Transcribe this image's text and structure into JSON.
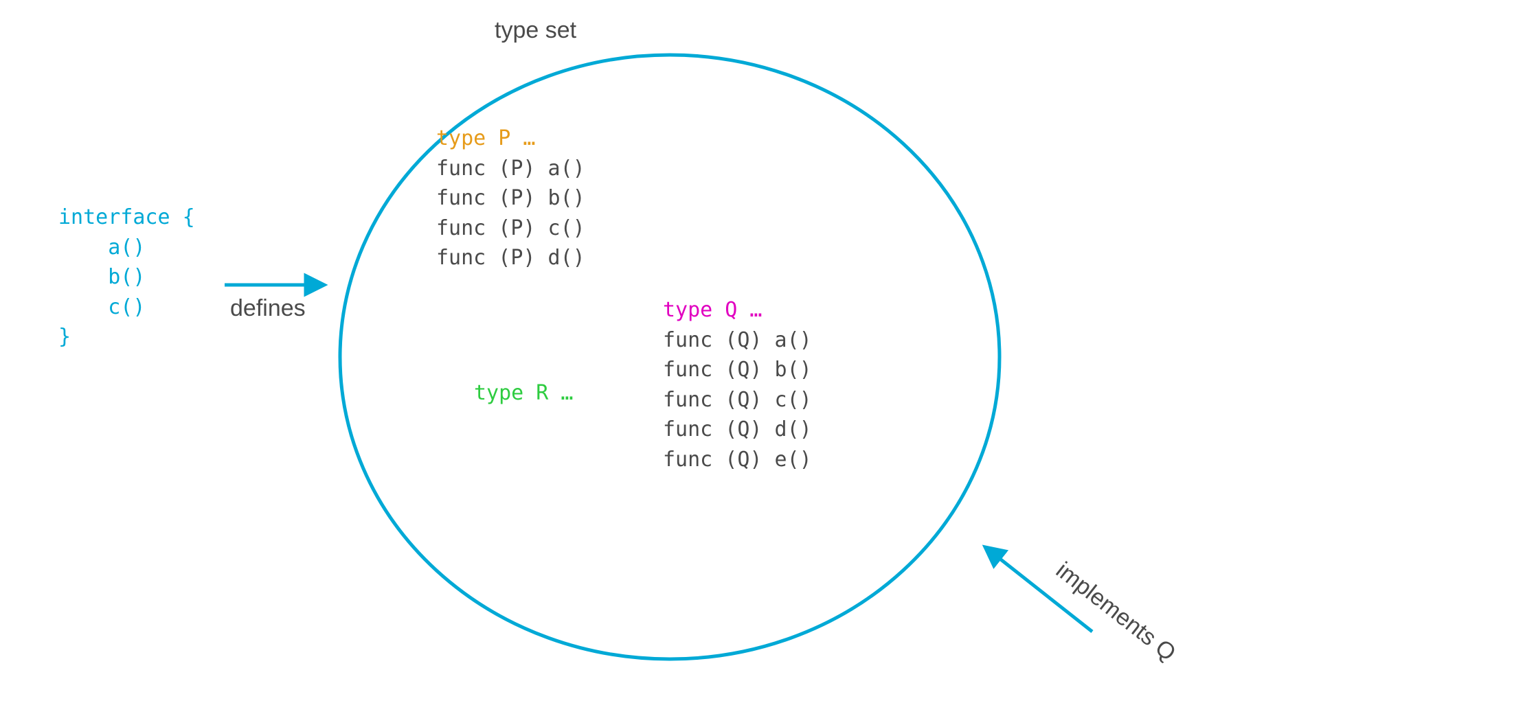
{
  "labels": {
    "type_set": "type set",
    "defines": "defines",
    "implements_q": "implements Q"
  },
  "interface": {
    "open": "interface {",
    "m1": "a()",
    "m2": "b()",
    "m3": "c()",
    "close": "}"
  },
  "type_p": {
    "decl": "type P …",
    "f1": "func (P) a()",
    "f2": "func (P) b()",
    "f3": "func (P) c()",
    "f4": "func (P) d()"
  },
  "type_r": {
    "decl": "type R …"
  },
  "type_q": {
    "decl": "type Q …",
    "f1": "func (Q) a()",
    "f2": "func (Q) b()",
    "f3": "func (Q) c()",
    "f4": "func (Q) d()",
    "f5": "func (Q) e()"
  },
  "colors": {
    "cyan": "#00a9d6",
    "orange": "#e69b1a",
    "green": "#2ecc40",
    "magenta": "#e100c0",
    "gray": "#4a4a4a"
  }
}
